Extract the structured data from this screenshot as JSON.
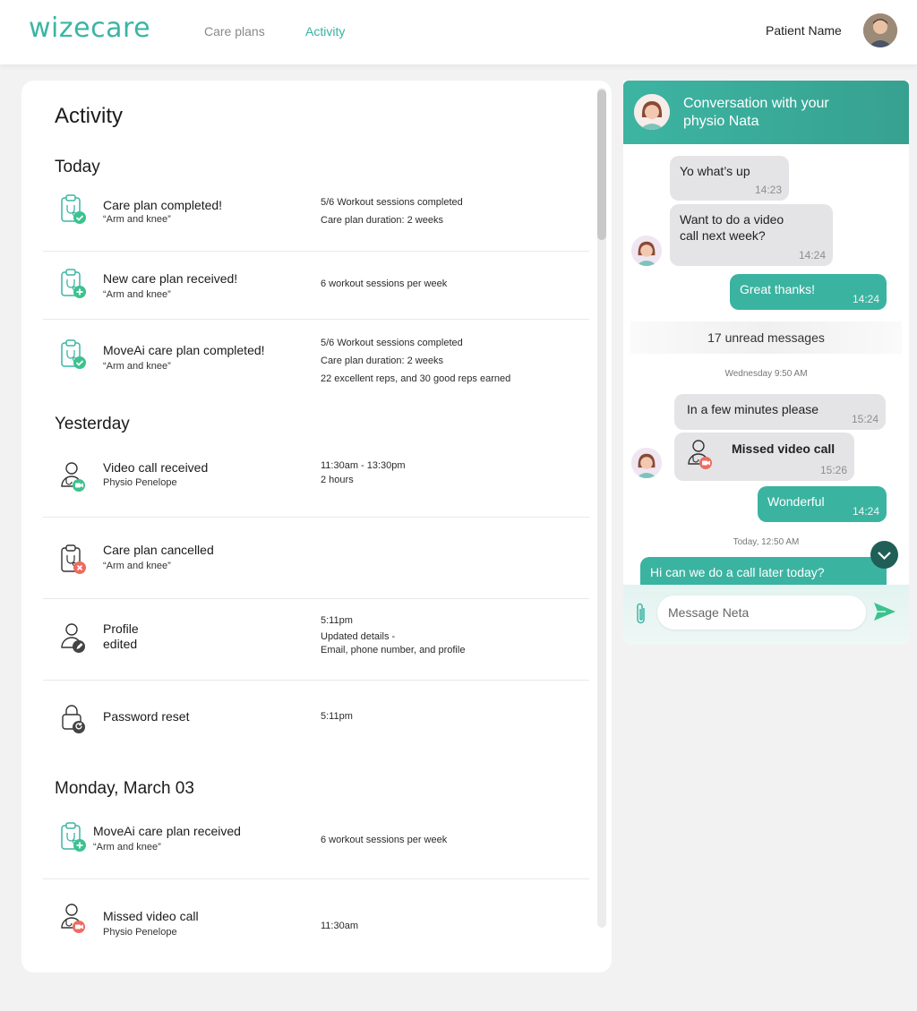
{
  "header": {
    "logo": "wizecare",
    "nav": [
      {
        "label": "Care plans",
        "active": false
      },
      {
        "label": "Activity",
        "active": true
      }
    ],
    "patient_name": "Patient Name"
  },
  "activity": {
    "title": "Activity",
    "sections": [
      {
        "title": "Today",
        "items": [
          {
            "icon": "clipboard-check-icon",
            "title": "Care plan completed!",
            "subtitle": "“Arm and knee”",
            "details": [
              "5/6 Workout sessions completed",
              "Care plan duration: 2 weeks"
            ]
          },
          {
            "icon": "clipboard-plus-icon",
            "title": "New care plan received!",
            "subtitle": "“Arm and knee”",
            "details": [
              "6 workout sessions per week"
            ]
          },
          {
            "icon": "clipboard-check-icon",
            "title": "MoveAi care plan completed!",
            "subtitle": "“Arm and knee”",
            "details": [
              "5/6 Workout sessions completed",
              "Care plan duration: 2 weeks",
              "22 excellent reps, and 30 good reps earned"
            ]
          }
        ]
      },
      {
        "title": "Yesterday",
        "items": [
          {
            "icon": "video-call-received-icon",
            "title": "Video call received",
            "subtitle": "Physio Penelope",
            "details": [
              "11:30am - 13:30pm",
              "2 hours"
            ]
          },
          {
            "icon": "clipboard-cancel-icon",
            "title": "Care plan cancelled",
            "subtitle": "“Arm and knee”",
            "details": []
          },
          {
            "icon": "profile-edit-icon",
            "title": "Profile\nedited",
            "subtitle": "",
            "details": [
              "5:11pm",
              "Updated details -",
              "Email, phone number, and profile"
            ]
          },
          {
            "icon": "password-reset-icon",
            "title": "Password reset",
            "subtitle": "",
            "details": [
              "5:11pm"
            ]
          }
        ]
      },
      {
        "title": "Monday, March 03",
        "items": [
          {
            "icon": "clipboard-plus-icon",
            "title": "MoveAi care plan received",
            "subtitle": "“Arm and knee”",
            "details": [
              "6 workout sessions per week"
            ]
          },
          {
            "icon": "missed-video-call-icon",
            "title": "Missed video call",
            "subtitle": "Physio Penelope",
            "details": [
              "11:30am"
            ]
          }
        ]
      }
    ]
  },
  "chat": {
    "title": "Conversation with your physio Nata",
    "messages": [
      {
        "dir": "in",
        "text": "Yo what’s up",
        "time": "14:23"
      },
      {
        "dir": "in",
        "text": "Want to do a video call next week?",
        "time": "14:24"
      },
      {
        "dir": "out",
        "text": "Great thanks!",
        "time": "14:24"
      },
      {
        "dir": "in",
        "text": "In a few minutes please",
        "time": "15:24"
      },
      {
        "dir": "in",
        "text": "Missed video call",
        "time": "15:26"
      },
      {
        "dir": "out",
        "text": "Wonderful",
        "time": "14:24"
      },
      {
        "dir": "out",
        "text": "Hi can we do a call later today?",
        "time": ""
      }
    ],
    "unread_label": "17 unread messages",
    "date_separators": [
      "Wednesday 9:50 AM",
      "Today, 12:50 AM"
    ],
    "input_placeholder": "Message Neta"
  },
  "colors": {
    "brand": "#3bb5a4",
    "outgoing_bubble": "#3bb3a1",
    "incoming_bubble": "#e4e4e6",
    "status_green": "#3cc28f",
    "status_red": "#ee6b5f",
    "status_dark": "#444444"
  }
}
